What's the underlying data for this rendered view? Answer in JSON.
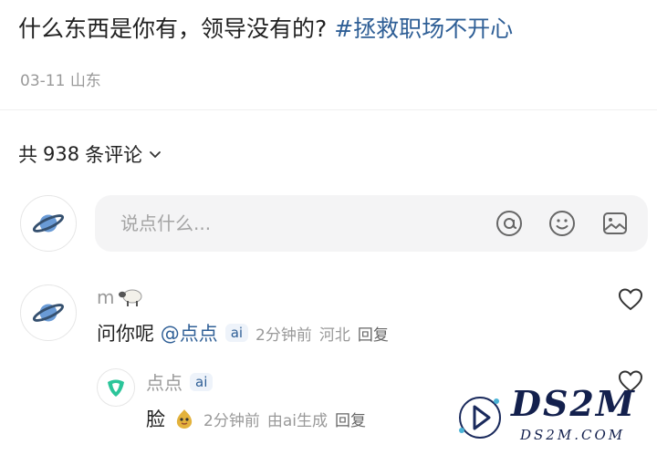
{
  "post": {
    "title": "什么东西是你有，领导没有的?",
    "hashtag": "#拯救职场不开心",
    "date": "03-11",
    "location": "山东"
  },
  "comments_header": {
    "prefix": "共",
    "count": "938",
    "suffix": "条评论"
  },
  "comment_input": {
    "placeholder": "说点什么..."
  },
  "comments": [
    {
      "username": "m",
      "text": "问你呢",
      "mention": "@点点",
      "badge": "ai",
      "time": "2分钟前",
      "location": "河北",
      "reply_label": "回复"
    }
  ],
  "reply": {
    "username": "点点",
    "badge": "ai",
    "text": "脸",
    "time": "2分钟前",
    "generated": "由ai生成",
    "reply_label": "回复"
  },
  "watermark": {
    "brand": "DS2M",
    "domain": "DS2M.COM"
  },
  "colors": {
    "hashtag": "#2f5f96",
    "muted": "#999999",
    "input_bg": "#f4f4f5"
  }
}
